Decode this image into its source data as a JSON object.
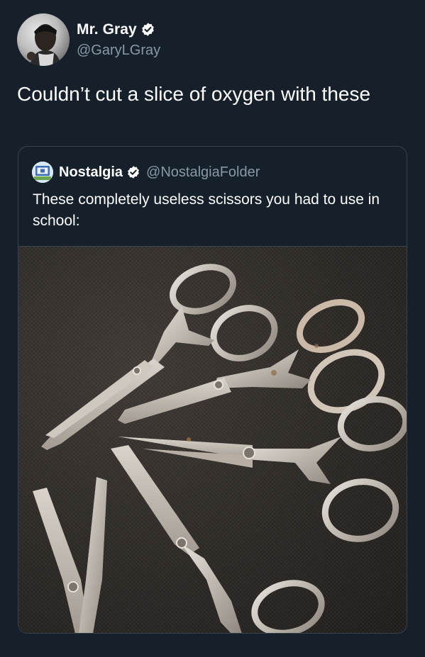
{
  "tweet": {
    "author": {
      "display_name": "Mr. Gray",
      "handle": "@GaryLGray",
      "verified_icon": "verified-badge-icon"
    },
    "text": "Couldn’t cut a slice of oxygen with these"
  },
  "quoted_tweet": {
    "author": {
      "display_name": "Nostalgia",
      "handle": "@NostalgiaFolder",
      "verified_icon": "verified-badge-icon"
    },
    "text": "These completely useless scissors you had to use in school:",
    "image": {
      "subject": "scissors-photo"
    }
  },
  "colors": {
    "background": "#15202b",
    "secondary_text": "#8899a6",
    "border": "#38444d"
  }
}
